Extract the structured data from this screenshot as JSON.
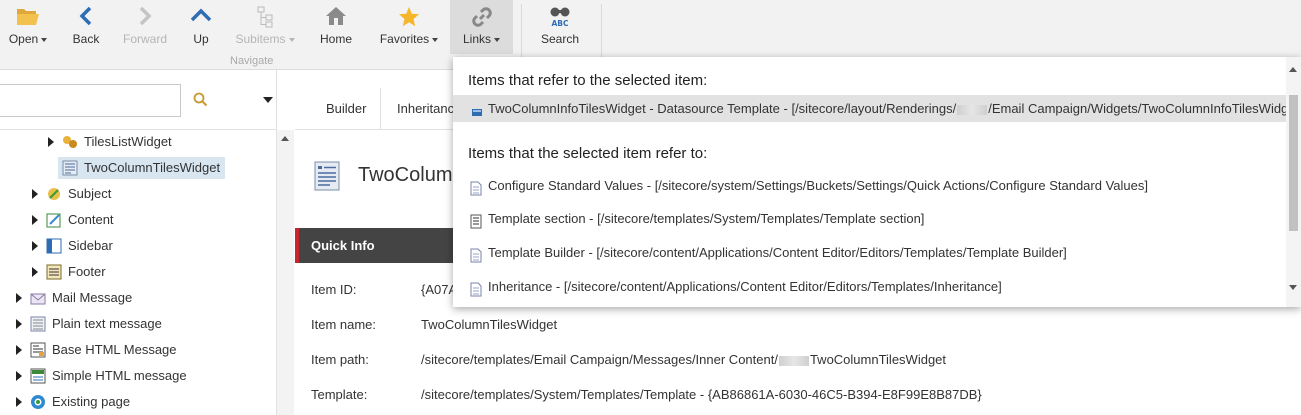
{
  "ribbon": {
    "open": "Open",
    "back": "Back",
    "forward": "Forward",
    "up": "Up",
    "subitems": "Subitems",
    "home": "Home",
    "favorites": "Favorites",
    "links": "Links",
    "search": "Search",
    "navigate_group": "Navigate"
  },
  "search": {
    "value": ""
  },
  "tree": [
    {
      "label": "TilesListWidget",
      "icon": "widget-icon",
      "expandable": true
    },
    {
      "label": "TwoColumnTilesWidget",
      "icon": "template-icon",
      "expandable": false,
      "selected": true
    },
    {
      "label": "Subject",
      "icon": "subject-icon",
      "expandable": true
    },
    {
      "label": "Content",
      "icon": "content-icon",
      "expandable": true
    },
    {
      "label": "Sidebar",
      "icon": "sidebar-icon",
      "expandable": true
    },
    {
      "label": "Footer",
      "icon": "footer-icon",
      "expandable": true
    },
    {
      "label": "Mail Message",
      "icon": "mail-icon",
      "expandable": true
    },
    {
      "label": "Plain text message",
      "icon": "plain-text-icon",
      "expandable": true
    },
    {
      "label": "Base HTML Message",
      "icon": "html-message-icon",
      "expandable": true
    },
    {
      "label": "Simple HTML message",
      "icon": "simple-html-icon",
      "expandable": true
    },
    {
      "label": "Existing page",
      "icon": "existing-page-icon",
      "expandable": true
    }
  ],
  "tabs": [
    "Builder",
    "Inheritanc"
  ],
  "item": {
    "title": "TwoColumn",
    "quick_info": "Quick Info",
    "fields": [
      {
        "label": "Item ID:",
        "value": "{A07A"
      },
      {
        "label": "Item name:",
        "value": "TwoColumnTilesWidget"
      },
      {
        "label": "Item path:",
        "value_before": "/sitecore/templates/Email Campaign/Messages/Inner Content/",
        "value_after": "TwoColumnTilesWidget"
      },
      {
        "label": "Template:",
        "value": "/sitecore/templates/System/Templates/Template - {AB86861A-6030-46C5-B394-E8F99E8B87DB}"
      }
    ]
  },
  "links_popup": {
    "referrers_heading": "Items that refer to the selected item:",
    "referrers": [
      {
        "before": "TwoColumnInfoTilesWidget - Datasource Template - [/sitecore/layout/Renderings/",
        "after": "/Email Campaign/Widgets/TwoColumnInfoTilesWidget]"
      }
    ],
    "references_heading": "Items that the selected item refer to:",
    "references": [
      {
        "text": "Configure Standard Values - [/sitecore/system/Settings/Buckets/Settings/Quick Actions/Configure Standard Values]"
      },
      {
        "text": "Template section - [/sitecore/templates/System/Templates/Template section]"
      },
      {
        "text": "Template Builder - [/sitecore/content/Applications/Content Editor/Editors/Templates/Template Builder]"
      },
      {
        "text": "Inheritance - [/sitecore/content/Applications/Content Editor/Editors/Templates/Inheritance]"
      }
    ]
  },
  "colors": {
    "accent_red": "#c8252c",
    "selected_row": "#d8e6f1",
    "quick_info_bar": "#444444"
  }
}
